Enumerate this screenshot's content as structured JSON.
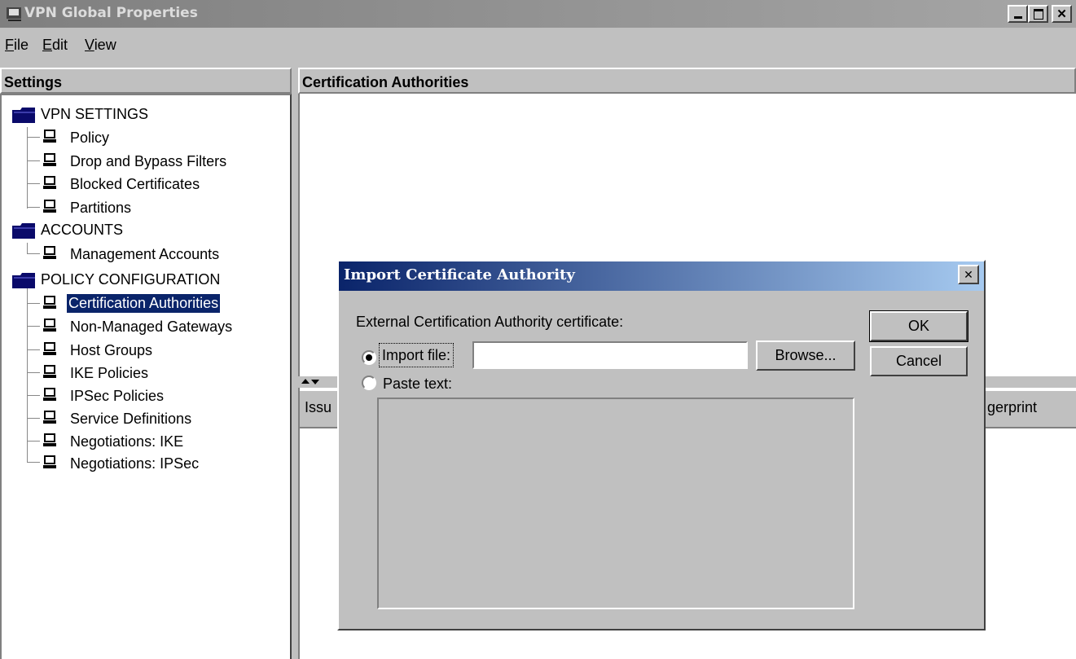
{
  "window": {
    "title": "VPN Global Properties"
  },
  "menubar": {
    "items": [
      "File",
      "Edit",
      "View"
    ]
  },
  "settings_panel": {
    "header": "Settings",
    "tree": [
      {
        "label": "VPN SETTINGS",
        "children": [
          "Policy",
          "Drop and Bypass Filters",
          "Blocked Certificates",
          "Partitions"
        ]
      },
      {
        "label": "ACCOUNTS",
        "children": [
          "Management Accounts"
        ]
      },
      {
        "label": "POLICY CONFIGURATION",
        "children": [
          "Certification Authorities",
          "Non-Managed Gateways",
          "Host Groups",
          "IKE Policies",
          "IPSec Policies",
          "Service Definitions",
          "Negotiations: IKE",
          "Negotiations: IPSec"
        ]
      }
    ],
    "selected": "Certification Authorities"
  },
  "main_panel": {
    "header": "Certification Authorities",
    "table_columns_visible": [
      "Issu",
      "gerprint"
    ]
  },
  "dialog": {
    "title": "Import Certificate Authority",
    "label": "External Certification Authority certificate:",
    "import_file_label": "Import file:",
    "import_file_value": "",
    "browse_label": "Browse...",
    "paste_text_label": "Paste text:",
    "selected_option": "Import file:",
    "ok_label": "OK",
    "cancel_label": "Cancel"
  }
}
